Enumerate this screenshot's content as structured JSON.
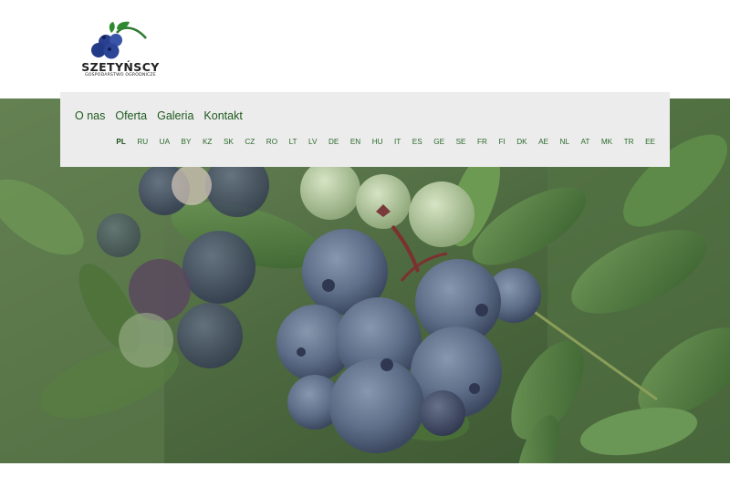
{
  "logo": {
    "name": "SZETYŃSCY",
    "subtitle": "GOSPODARSTWO OGRODNICZE"
  },
  "menu": [
    {
      "label": "O nas"
    },
    {
      "label": "Oferta"
    },
    {
      "label": "Galeria"
    },
    {
      "label": "Kontakt"
    }
  ],
  "languages": {
    "active": "PL",
    "items": [
      "PL",
      "RU",
      "UA",
      "BY",
      "KZ",
      "SK",
      "CZ",
      "RO",
      "LT",
      "LV",
      "DE",
      "EN",
      "HU",
      "IT",
      "ES",
      "GE",
      "SE",
      "FR",
      "FI",
      "DK",
      "AE",
      "NL",
      "AT",
      "MK",
      "TR",
      "EE"
    ]
  },
  "colors": {
    "menu_text": "#1f5a1f",
    "navbar_bg": "#ececec",
    "blueberry": "#5b6c86",
    "leaf": "#4f7a3c"
  },
  "hero": {
    "image_icon": "blueberry-photo"
  }
}
